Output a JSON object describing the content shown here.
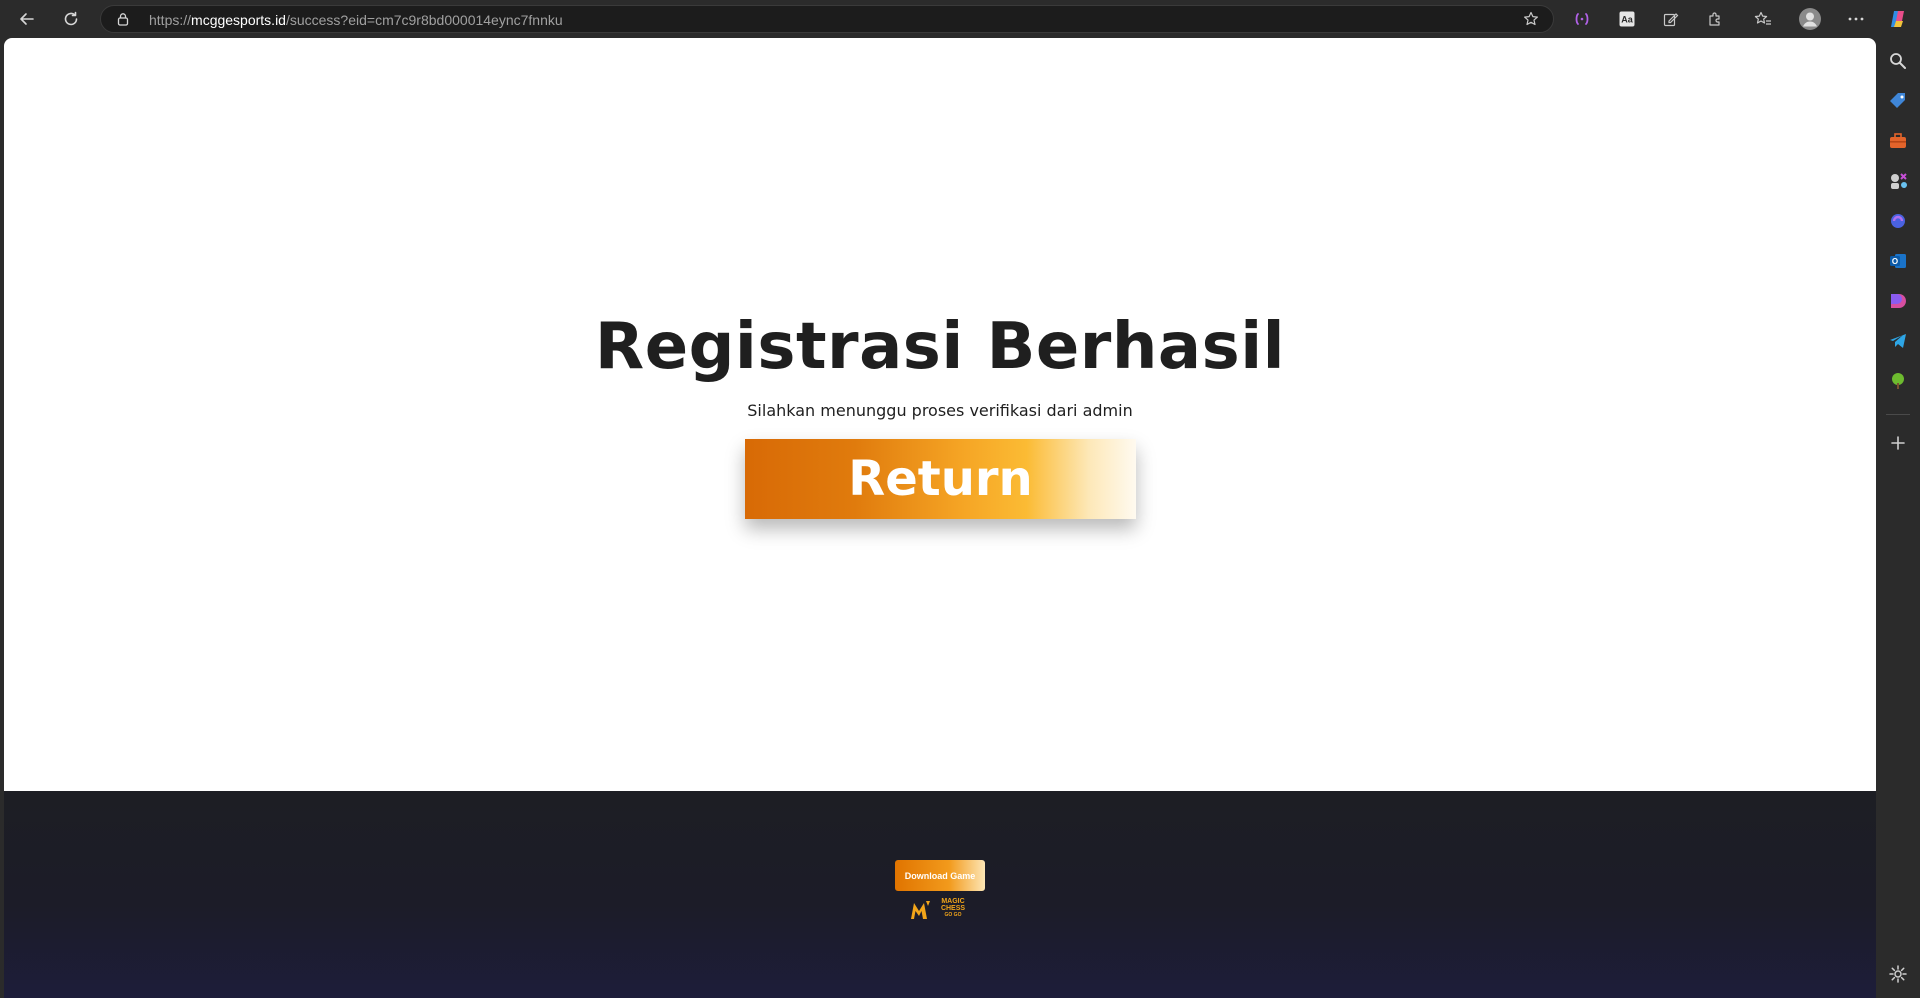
{
  "browser": {
    "url_scheme": "https://",
    "url_host": "mcggesports.id",
    "url_path": "/success?eid=cm7c9r8bd000014eync7fnnku"
  },
  "page": {
    "title": "Registrasi Berhasil",
    "subtitle": "Silahkan menunggu proses verifikasi dari admin",
    "return_label": "Return"
  },
  "footer": {
    "download_label": "Download Game",
    "logo_line1": "MAGIC",
    "logo_line2": "CHESS",
    "logo_line3": "GO GO"
  },
  "colors": {
    "accent_orange": "#e07400",
    "footer_bg": "#1d1e24",
    "title_text": "#1f1f1f"
  },
  "icons": {
    "toolbar": [
      "back-arrow-icon",
      "reload-icon",
      "lock-icon",
      "star-icon",
      "copilot-extension-icon",
      "read-aloud-icon",
      "edit-icon",
      "extensions-icon",
      "favorites-icon",
      "profile-avatar-icon",
      "more-menu-icon",
      "copilot-icon"
    ],
    "sidebar": [
      "search-icon",
      "shopping-tag-icon",
      "toolbox-icon",
      "games-icon",
      "copilot-sidebar-icon",
      "outlook-icon",
      "designer-icon",
      "telegram-icon",
      "tree-icon",
      "add-icon",
      "settings-icon"
    ]
  }
}
